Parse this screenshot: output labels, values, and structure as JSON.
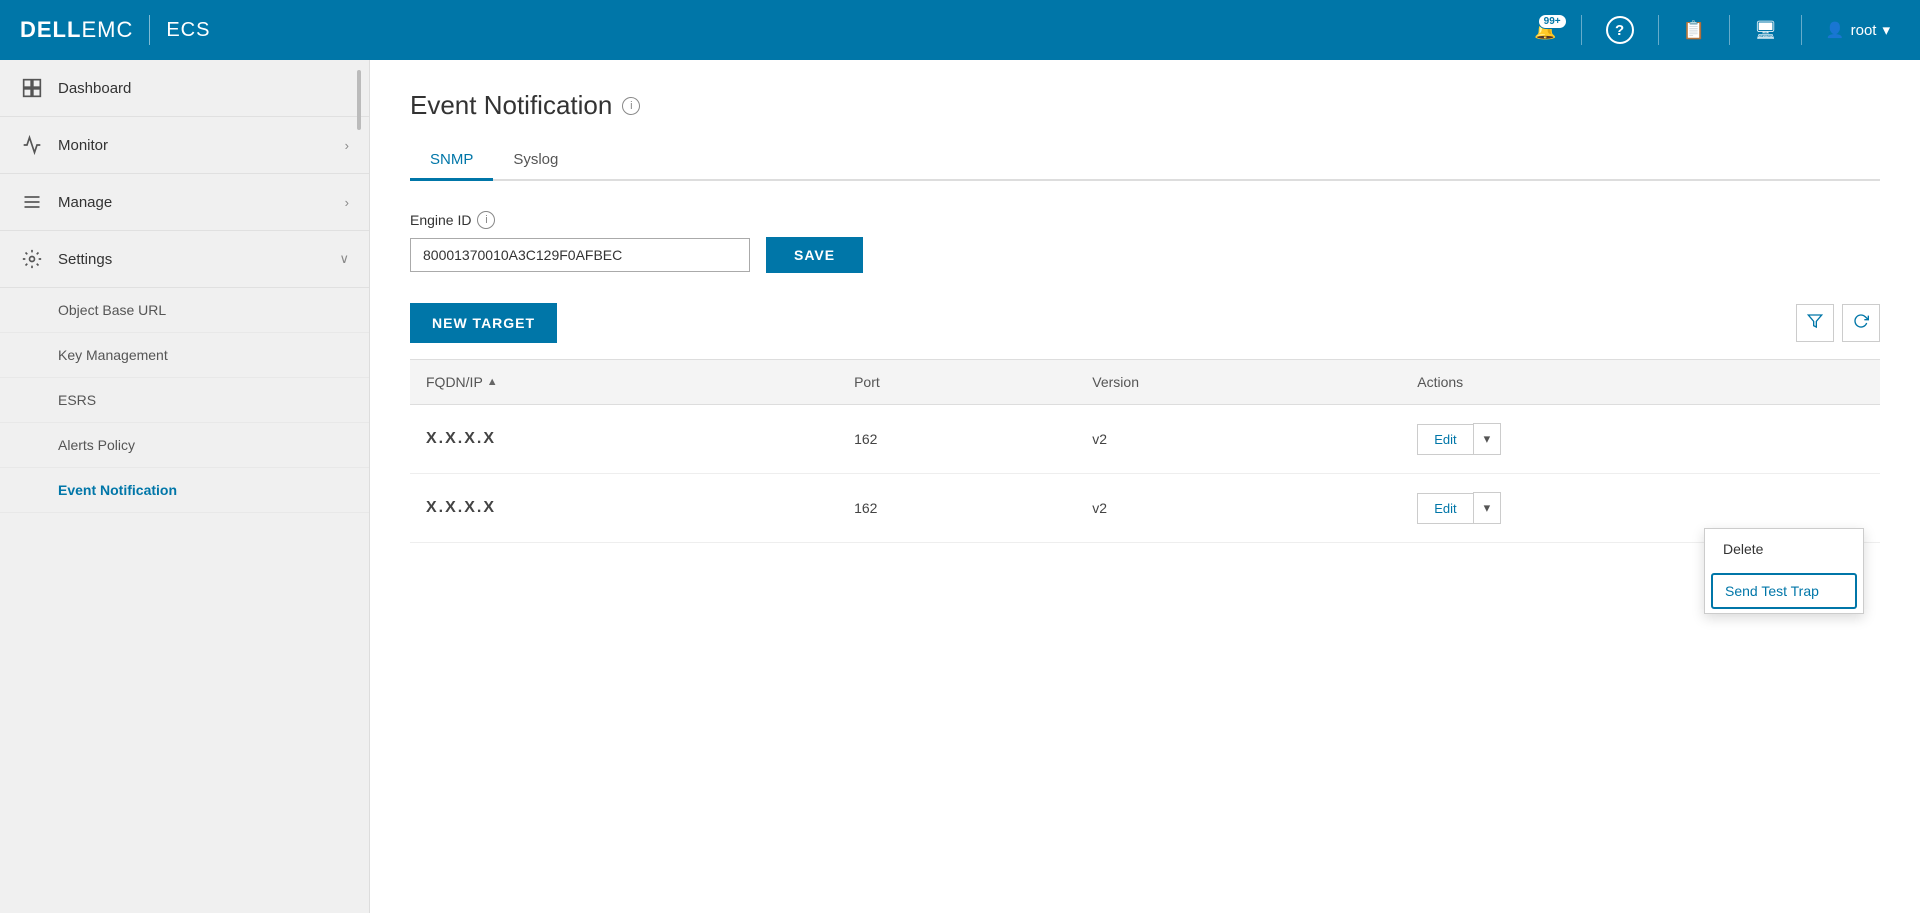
{
  "brand": {
    "dell": "DELL",
    "emc": "EMC",
    "divider": "|",
    "product": "ECS"
  },
  "navbar": {
    "notification_count": "99+",
    "user_label": "root"
  },
  "sidebar": {
    "items": [
      {
        "id": "dashboard",
        "label": "Dashboard",
        "icon": "▦",
        "has_chevron": false
      },
      {
        "id": "monitor",
        "label": "Monitor",
        "icon": "📊",
        "has_chevron": true
      },
      {
        "id": "manage",
        "label": "Manage",
        "icon": "☰",
        "has_chevron": true
      },
      {
        "id": "settings",
        "label": "Settings",
        "icon": "⚙",
        "has_chevron": true
      }
    ],
    "sub_items": [
      {
        "id": "object-base-url",
        "label": "Object Base URL",
        "active": false
      },
      {
        "id": "key-management",
        "label": "Key Management",
        "active": false
      },
      {
        "id": "esrs",
        "label": "ESRS",
        "active": false
      },
      {
        "id": "alerts-policy",
        "label": "Alerts Policy",
        "active": false
      },
      {
        "id": "event-notification",
        "label": "Event Notification",
        "active": true
      }
    ]
  },
  "page": {
    "title": "Event Notification",
    "tabs": [
      {
        "id": "snmp",
        "label": "SNMP",
        "active": true
      },
      {
        "id": "syslog",
        "label": "Syslog",
        "active": false
      }
    ],
    "engine_id_label": "Engine ID",
    "engine_id_value": "80001370010A3C129F0AFBEC",
    "save_button": "SAVE",
    "new_target_button": "NEW TARGET",
    "table": {
      "columns": [
        {
          "id": "fqdn",
          "label": "FQDN/IP",
          "sortable": true
        },
        {
          "id": "port",
          "label": "Port",
          "sortable": false
        },
        {
          "id": "version",
          "label": "Version",
          "sortable": false
        },
        {
          "id": "actions",
          "label": "Actions",
          "sortable": false
        }
      ],
      "rows": [
        {
          "fqdn": "X.X.X.X",
          "port": "162",
          "version": "v2",
          "show_dropdown": false
        },
        {
          "fqdn": "X.X.X.X",
          "port": "162",
          "version": "v2",
          "show_dropdown": true
        }
      ]
    },
    "dropdown_menu": {
      "delete_label": "Delete",
      "send_test_trap_label": "Send Test Trap"
    },
    "edit_button": "Edit"
  }
}
